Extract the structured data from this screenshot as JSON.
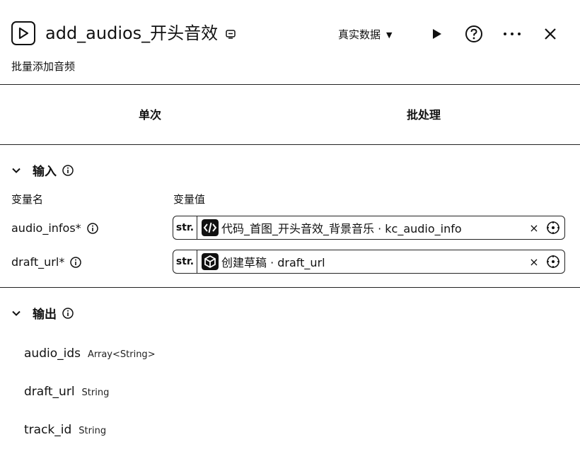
{
  "header": {
    "title": "add_audios_开头音效",
    "subtitle": "批量添加音频",
    "data_mode": "真实数据"
  },
  "tabs": [
    {
      "label": "单次"
    },
    {
      "label": "批处理"
    }
  ],
  "input": {
    "title": "输入",
    "col_name": "变量名",
    "col_value": "变量值",
    "params": [
      {
        "name": "audio_infos*",
        "type": "str.",
        "value": "代码_首图_开头音效_背景音乐 · kc_audio_info",
        "node_icon": "code-node-icon"
      },
      {
        "name": "draft_url*",
        "type": "str.",
        "value": "创建草稿 · draft_url",
        "node_icon": "plugin-node-icon"
      }
    ]
  },
  "output": {
    "title": "输出",
    "items": [
      {
        "name": "audio_ids",
        "type": "Array<String>"
      },
      {
        "name": "draft_url",
        "type": "String"
      },
      {
        "name": "track_id",
        "type": "String"
      }
    ]
  }
}
